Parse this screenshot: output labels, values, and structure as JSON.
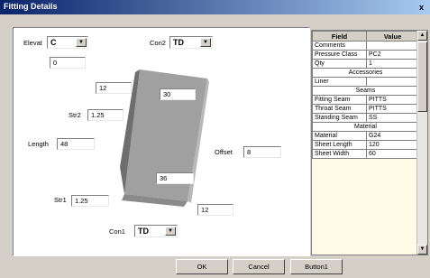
{
  "window": {
    "title": "Fitting Details",
    "close": "x"
  },
  "labels": {
    "elevat": "Elevat",
    "con2": "Con2",
    "str2": "Str2",
    "length": "Length",
    "offset": "Offset",
    "str1": "Str1",
    "con1": "Con1"
  },
  "fields": {
    "elevat": "C",
    "elevat_value": "0",
    "con2": "TD",
    "top_left": "12",
    "top_right": "30",
    "str2": "1.25",
    "length": "48",
    "offset": "8",
    "bottom_inner": "36",
    "bottom_right": "12",
    "str1": "1.25",
    "con1": "TD"
  },
  "grid": {
    "headers": [
      "Field",
      "Value"
    ],
    "rows": [
      {
        "field": "Comments",
        "value": ""
      },
      {
        "field": "Pressure Class",
        "value": "PC2"
      },
      {
        "field": "Qty",
        "value": "1"
      },
      {
        "section": "Accessories"
      },
      {
        "field": "Liner",
        "value": ""
      },
      {
        "section": "Seams"
      },
      {
        "field": "Fitting Seam",
        "value": "PITTS"
      },
      {
        "field": "Throat Seam",
        "value": "PITTS"
      },
      {
        "field": "Standing Seam",
        "value": "SS"
      },
      {
        "section": "Material"
      },
      {
        "field": "Material",
        "value": "G24"
      },
      {
        "field": "Sheet Length",
        "value": "120"
      },
      {
        "field": "Sheet Width",
        "value": "60"
      }
    ]
  },
  "buttons": {
    "ok": "OK",
    "cancel": "Cancel",
    "button1": "Button1"
  },
  "icons": {
    "dropdown": "chevron-down-icon",
    "scroll_up": "arrow-up-icon",
    "scroll_down": "arrow-down-icon"
  },
  "colors": {
    "titlebar": "#0a246a",
    "duct_front": "#a0a0a0",
    "duct_side": "#6e6e6e",
    "duct_bottom": "#8a8a8a"
  }
}
